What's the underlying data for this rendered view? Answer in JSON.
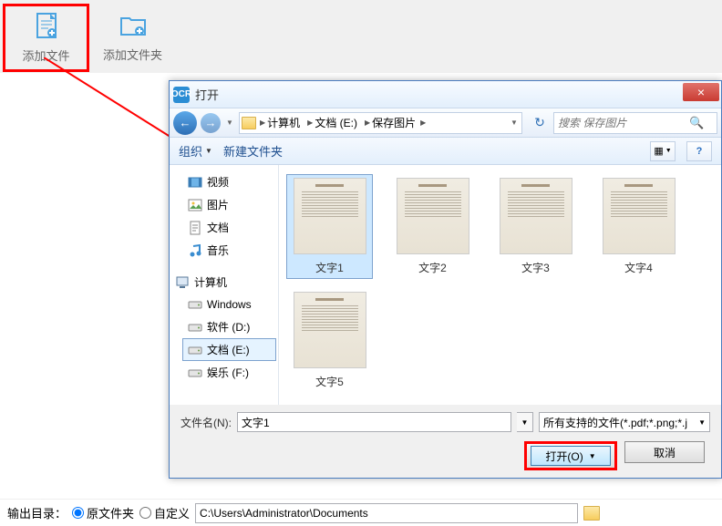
{
  "toolbar": {
    "add_file": "添加文件",
    "add_folder": "添加文件夹"
  },
  "dialog": {
    "title": "打开",
    "close": "×",
    "nav": {
      "path_segs": [
        "计算机",
        "文档 (E:)",
        "保存图片"
      ],
      "search_placeholder": "搜索 保存图片"
    },
    "cmdbar": {
      "organize": "组织",
      "new_folder": "新建文件夹"
    },
    "tree": [
      {
        "icon": "video",
        "label": "视频"
      },
      {
        "icon": "image",
        "label": "图片"
      },
      {
        "icon": "doc",
        "label": "文档"
      },
      {
        "icon": "music",
        "label": "音乐"
      },
      {
        "gap": true
      },
      {
        "icon": "computer",
        "label": "计算机",
        "group": true
      },
      {
        "icon": "drive",
        "label": "Windows"
      },
      {
        "icon": "drive",
        "label": "软件 (D:)"
      },
      {
        "icon": "drive",
        "label": "文档 (E:)",
        "selected": true
      },
      {
        "icon": "drive",
        "label": "娱乐 (F:)"
      }
    ],
    "files": [
      {
        "name": "文字1",
        "selected": true
      },
      {
        "name": "文字2"
      },
      {
        "name": "文字3"
      },
      {
        "name": "文字4"
      },
      {
        "name": "文字5"
      }
    ],
    "footer": {
      "filename_label": "文件名(N):",
      "filename_value": "文字1",
      "filter": "所有支持的文件(*.pdf;*.png;*.j",
      "open_btn": "打开(O)",
      "cancel_btn": "取消"
    }
  },
  "bottom": {
    "output_label": "输出目录：",
    "opt_src": "原文件夹",
    "opt_custom": "自定义",
    "path": "C:\\Users\\Administrator\\Documents"
  }
}
